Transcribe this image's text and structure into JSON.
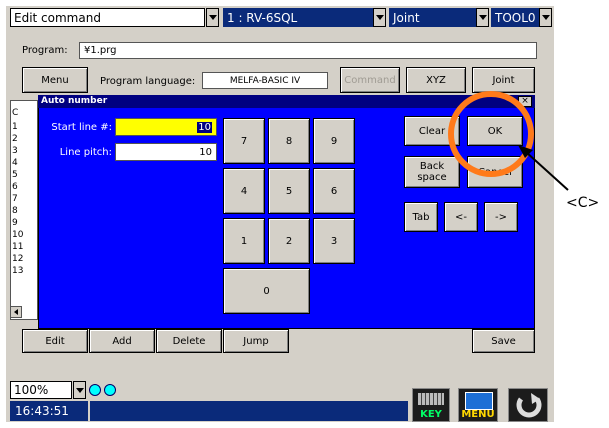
{
  "topbar": {
    "command": "Edit command",
    "robot": "1 : RV-6SQL",
    "coord": "Joint",
    "tool": "TOOL0"
  },
  "program": {
    "label": "Program:",
    "value": "¥1.prg"
  },
  "toolbar": {
    "menu": "Menu",
    "lang_label": "Program language:",
    "lang_value": "MELFA-BASIC IV",
    "command": "Command",
    "xyz": "XYZ",
    "joint": "Joint"
  },
  "line_numbers": [
    "1",
    "2",
    "3",
    "4",
    "5",
    "6",
    "7",
    "8",
    "9",
    "10",
    "11",
    "12",
    "13"
  ],
  "left_header": "C",
  "dialog": {
    "title": "Auto number",
    "start_label": "Start line #:",
    "start_value": "10",
    "pitch_label": "Line pitch:",
    "pitch_value": "10",
    "keys": [
      "7",
      "8",
      "9",
      "4",
      "5",
      "6",
      "1",
      "2",
      "3",
      "0"
    ],
    "clear": "Clear",
    "ok": "OK",
    "back": "Back",
    "space": "space",
    "cancel": "Cancel",
    "tab": "Tab",
    "left": "<-",
    "right": "->"
  },
  "bottom": {
    "edit": "Edit",
    "add": "Add",
    "delete": "Delete",
    "jump": "Jump",
    "save": "Save"
  },
  "zoom": "100%",
  "time": "16:43:51",
  "icons": {
    "key_label": "KEY",
    "menu_label": "MENU"
  },
  "annotation": "<C>",
  "colors": {
    "dialog_bg": "#0000ff",
    "highlight": "#ffff00",
    "callout": "#ff7a1a",
    "status_bg": "#0a2a7a"
  }
}
